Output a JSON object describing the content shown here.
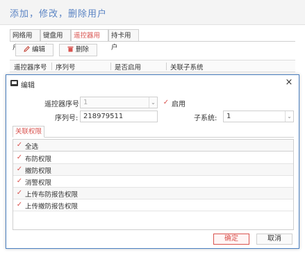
{
  "page": {
    "title": "添加，修改，删除用户"
  },
  "outer_tabs": [
    {
      "label": "网络用户"
    },
    {
      "label": "键盘用户"
    },
    {
      "label": "遥控器用户"
    },
    {
      "label": "持卡用户"
    }
  ],
  "outer_active_tab": "遥控器用户",
  "toolbar": {
    "edit_label": "编辑",
    "delete_label": "删除",
    "edit_icon": "pencil-edit-icon",
    "delete_icon": "trash-icon"
  },
  "bg_table": {
    "columns": [
      "遥控器序号",
      "序列号",
      "是否启用",
      "关联子系统"
    ]
  },
  "dialog": {
    "title": "编辑",
    "close_glyph": "×",
    "remote_index_label": "遥控器序号:",
    "remote_index_value": "1",
    "enable_label": "启用",
    "enable_checked": true,
    "serial_label": "序列号:",
    "serial_value": "218979511",
    "subsystem_label": "子系统:",
    "subsystem_value": "1",
    "inner_tab_label": "关联权限",
    "select_all_label": "全选",
    "permissions": [
      {
        "label": "布防权限",
        "checked": true
      },
      {
        "label": "撤防权限",
        "checked": true
      },
      {
        "label": "消警权限",
        "checked": true
      },
      {
        "label": "上传布防报告权限",
        "checked": true
      },
      {
        "label": "上传撤防报告权限",
        "checked": true
      }
    ],
    "confirm_label": "确定",
    "cancel_label": "取消"
  },
  "colors": {
    "accent_red": "#d9534f",
    "title_blue": "#5b84c4",
    "dialog_border": "#4a7fc1"
  }
}
